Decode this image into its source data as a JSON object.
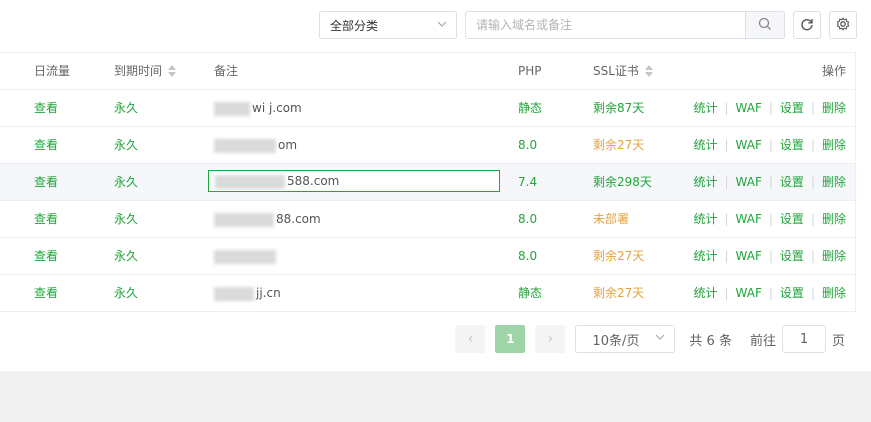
{
  "toolbar": {
    "category_value": "全部分类",
    "search_placeholder": "请输入域名或备注"
  },
  "columns": {
    "flow": "日流量",
    "expire": "到期时间",
    "note": "备注",
    "php": "PHP",
    "ssl": "SSL证书",
    "ops": "操作"
  },
  "rows": [
    {
      "flow": "查看",
      "expire": "永久",
      "note": "wi j.com",
      "php": "静态",
      "ssl": "剩余87天",
      "ssl_status": "green"
    },
    {
      "flow": "查看",
      "expire": "永久",
      "note": "om",
      "php": "8.0",
      "ssl": "剩余27天",
      "ssl_status": "orange"
    },
    {
      "flow": "查看",
      "expire": "永久",
      "note": "588.com",
      "php": "7.4",
      "ssl": "剩余298天",
      "ssl_status": "green"
    },
    {
      "flow": "查看",
      "expire": "永久",
      "note": "88.com",
      "php": "8.0",
      "ssl": "未部署",
      "ssl_status": "orange"
    },
    {
      "flow": "查看",
      "expire": "永久",
      "note": "",
      "php": "8.0",
      "ssl": "剩余27天",
      "ssl_status": "orange"
    },
    {
      "flow": "查看",
      "expire": "永久",
      "note": "jj.cn",
      "php": "静态",
      "ssl": "剩余27天",
      "ssl_status": "orange"
    }
  ],
  "row_ops": {
    "stats": "统计",
    "waf": "WAF",
    "settings": "设置",
    "delete": "删除",
    "separator": "|"
  },
  "pagination": {
    "current_page": "1",
    "prev": "‹",
    "next": "›",
    "page_size": "10条/页",
    "total": "共 6 条",
    "goto_prefix": "前往",
    "goto_value": "1",
    "goto_suffix": "页"
  },
  "colors": {
    "accent": "#20a53a",
    "warning": "#e6a23c",
    "active_page": "#9fd3a8"
  },
  "icons": [
    "chevron-down-icon",
    "search-icon",
    "refresh-icon",
    "gear-icon",
    "sort-icon"
  ]
}
